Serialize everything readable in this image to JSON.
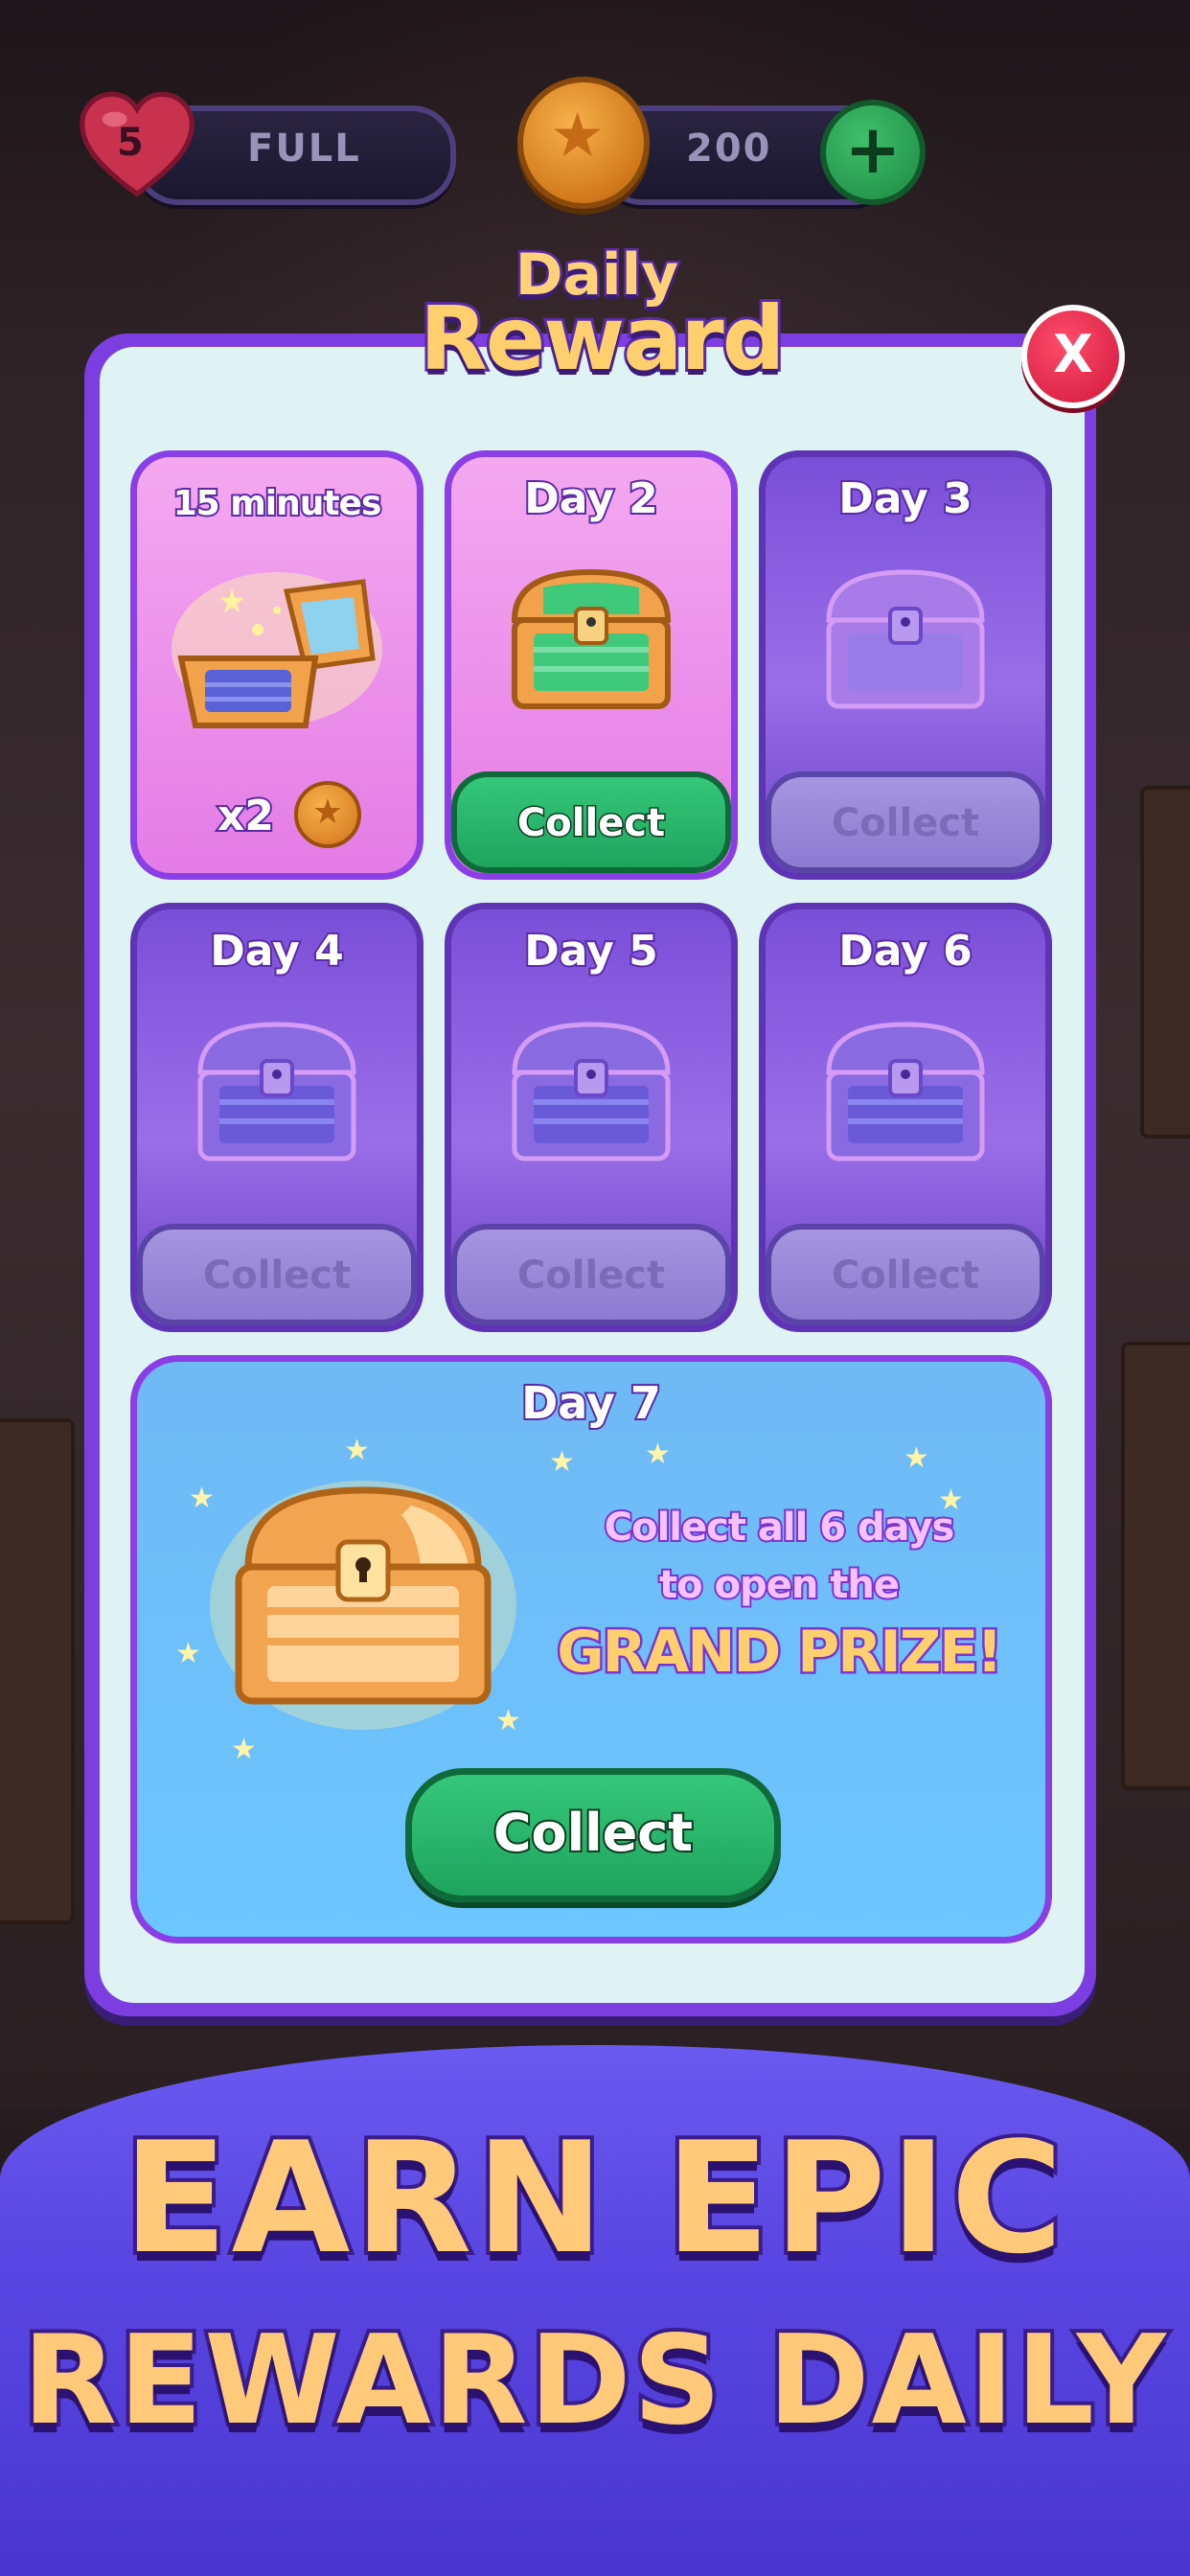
{
  "hud": {
    "lives_count": "5",
    "lives_status": "FULL",
    "coins": "200",
    "add_symbol": "+"
  },
  "modal": {
    "title_line1": "Daily",
    "title_line2": "Reward",
    "close_symbol": "X"
  },
  "cards": [
    {
      "label": "15 minutes",
      "multiplier": "x2",
      "state": "opened"
    },
    {
      "label": "Day 2",
      "button": "Collect",
      "state": "available"
    },
    {
      "label": "Day 3",
      "button": "Collect",
      "state": "locked"
    },
    {
      "label": "Day 4",
      "button": "Collect",
      "state": "locked"
    },
    {
      "label": "Day 5",
      "button": "Collect",
      "state": "locked"
    },
    {
      "label": "Day 6",
      "button": "Collect",
      "state": "locked"
    }
  ],
  "grand_prize": {
    "label": "Day 7",
    "line1": "Collect all 6 days",
    "line2": "to open the",
    "line3": "GRAND PRIZE!",
    "button": "Collect"
  },
  "banner": {
    "line1": "EARN EPIC",
    "line2": "REWARDS DAILY"
  },
  "colors": {
    "modal_border": "#7c3ee0",
    "active_card": "#e47ce6",
    "locked_card": "#7a4fd8",
    "collect_green": "#1fa45d",
    "close_red": "#d0163c",
    "grand_prize_bg": "#6cc6ff",
    "banner_bg": "#5a46e2",
    "headline_gold": "#ffc97a"
  },
  "icons": [
    "heart-icon",
    "coin-icon",
    "plus-icon",
    "close-icon",
    "chest-icon",
    "star-icon"
  ]
}
